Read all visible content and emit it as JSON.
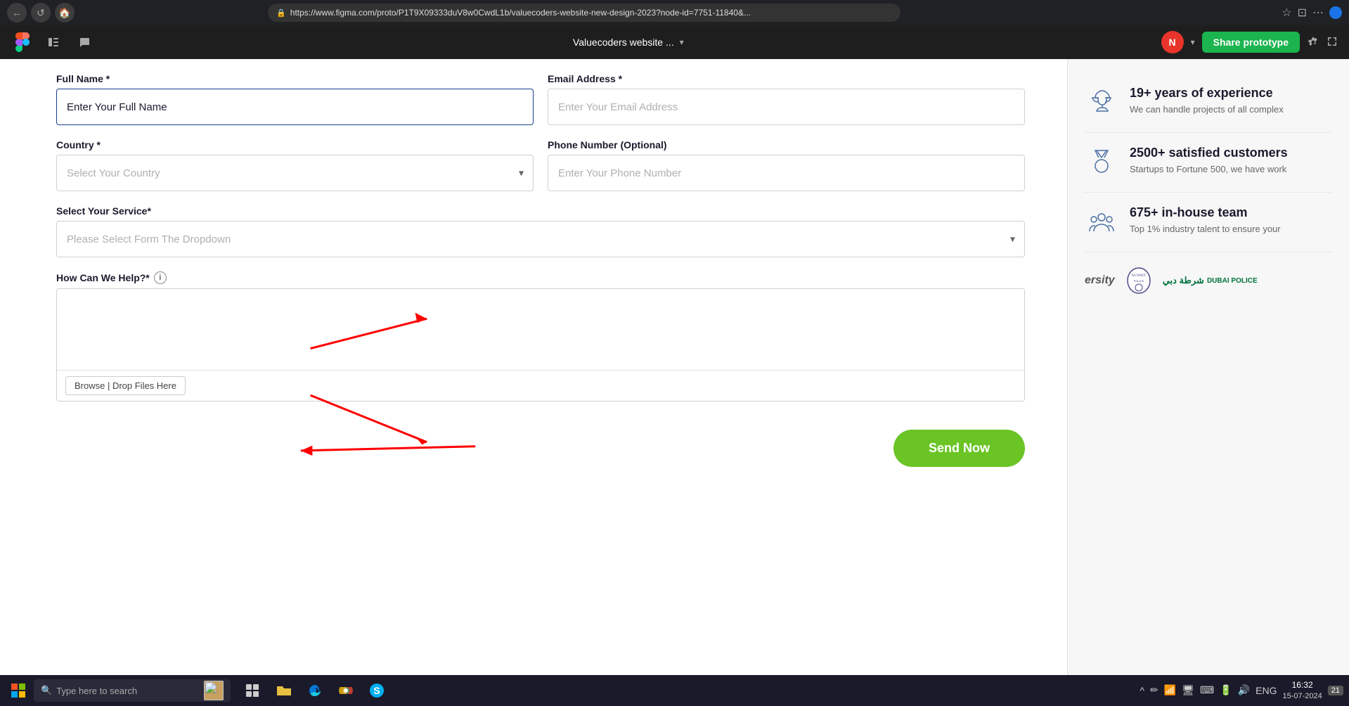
{
  "browser": {
    "url": "https://www.figma.com/proto/P1T9X09333duV8w0CwdL1b/valuecoders-website-new-design-2023?node-id=7751-11840&...",
    "back_btn": "←",
    "reload_btn": "↺"
  },
  "figma": {
    "title": "Valuecoders website ...",
    "share_label": "Share prototype",
    "avatar_initial": "N",
    "menu_arrow": "▾"
  },
  "form": {
    "full_name_label": "Full Name *",
    "full_name_placeholder": "Enter Your Full Name",
    "full_name_value": "Enter Your Full Name",
    "email_label": "Email Address *",
    "email_placeholder": "Enter Your Email Address",
    "country_label": "Country *",
    "country_placeholder": "Select Your Country",
    "phone_label": "Phone Number (Optional)",
    "phone_placeholder": "Enter Your Phone Number",
    "service_label": "Select Your Service*",
    "service_placeholder": "Please Select Form The Dropdown",
    "how_help_label": "How Can We Help?*",
    "browse_label": "Browse | Drop Files Here",
    "send_label": "Send Now"
  },
  "sidebar": {
    "stats": [
      {
        "icon": "trophy",
        "title": "19+ years of experience",
        "description": "We can handle projects of all complex"
      },
      {
        "icon": "medal",
        "title": "2500+ satisfied customers",
        "description": "Startups to Fortune 500, we have work"
      },
      {
        "icon": "team",
        "title": "675+ in-house team",
        "description": "Top 1% industry talent to ensure your"
      }
    ],
    "clients": [
      {
        "name": "ersity"
      },
      {
        "name": "Kuwait Police"
      },
      {
        "name": "Dubai Police"
      }
    ]
  },
  "taskbar": {
    "search_placeholder": "Type here to search",
    "time": "16:32",
    "date": "15-07-2024",
    "language": "ENG",
    "notification_count": "21"
  }
}
